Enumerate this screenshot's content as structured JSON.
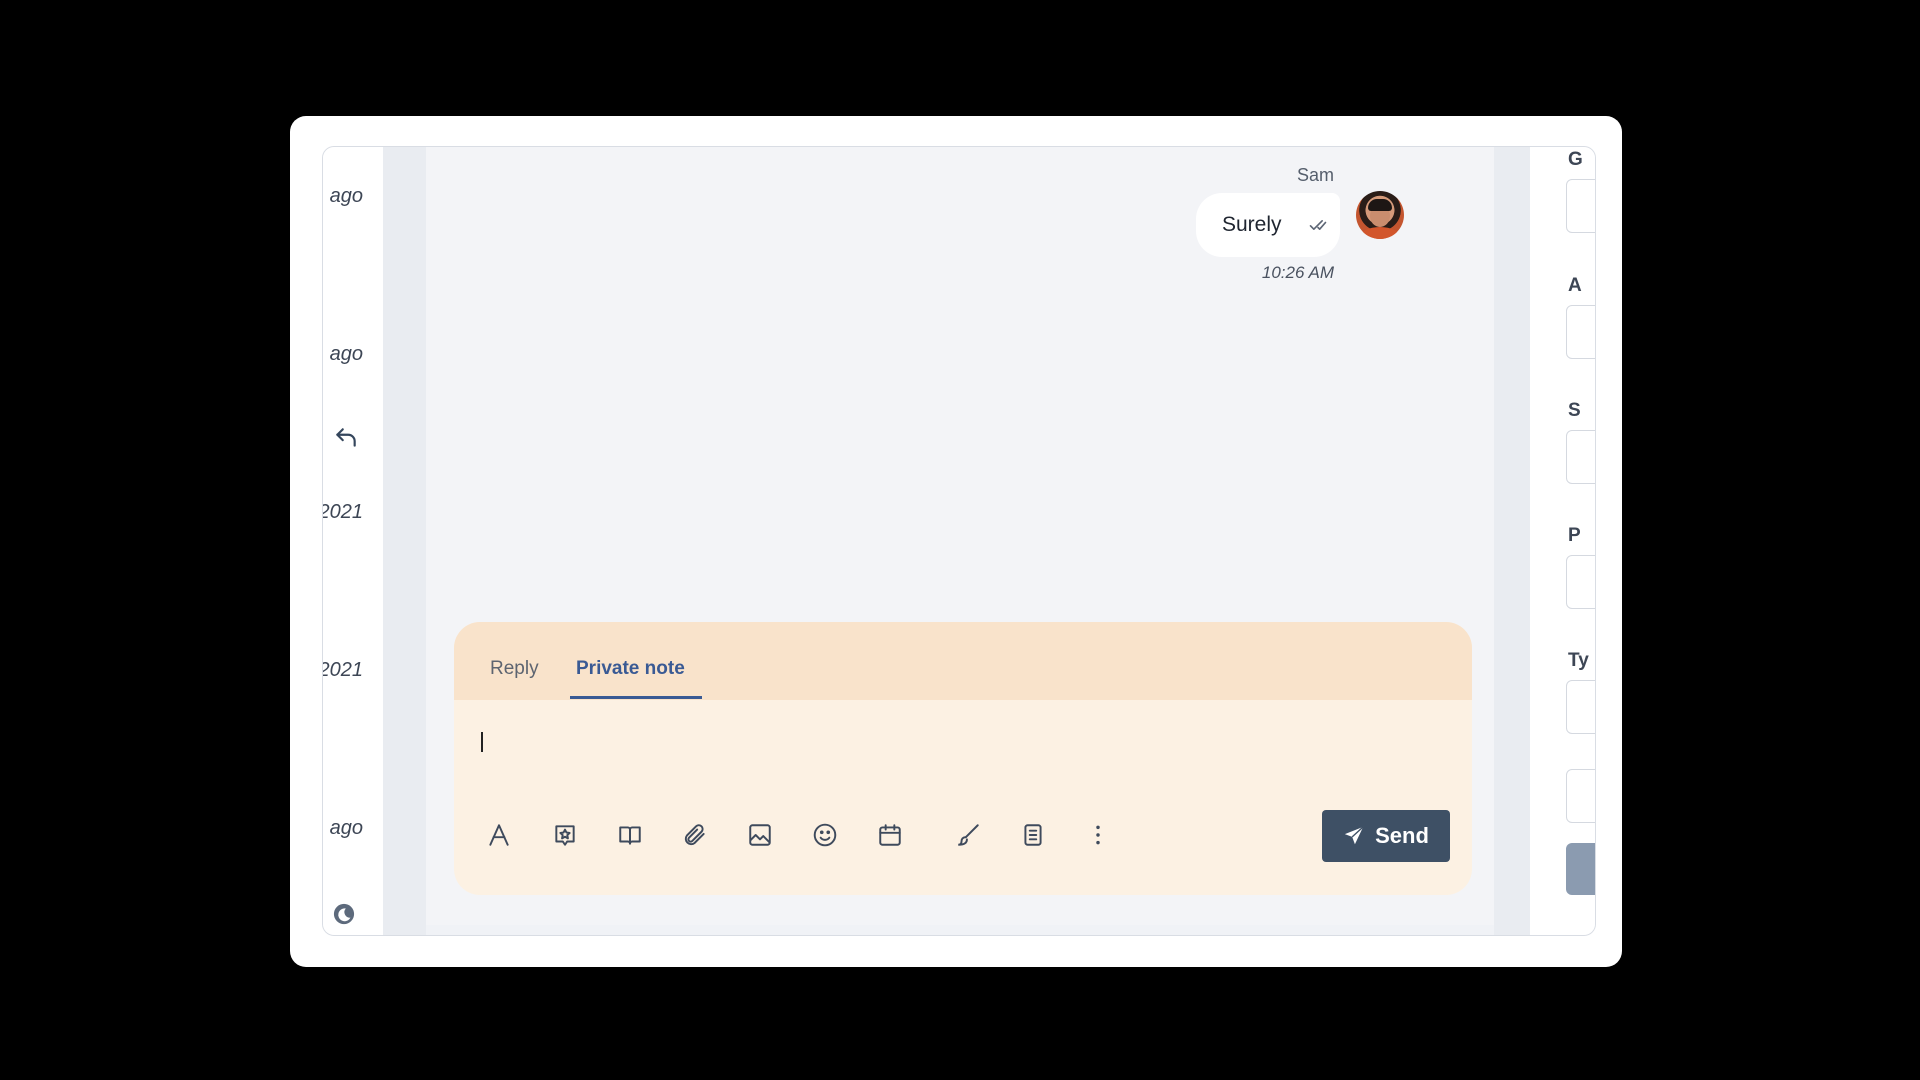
{
  "left_list": {
    "times": [
      "ago",
      "ago",
      "2021",
      "2021",
      "ago"
    ]
  },
  "conversation": {
    "sender": "Sam",
    "message": "Surely",
    "time": "10:26 AM"
  },
  "composer": {
    "tabs": [
      {
        "label": "Reply",
        "active": false
      },
      {
        "label": "Private note",
        "active": true
      }
    ],
    "toolbar_icons": [
      "text-format-icon",
      "canned-response-icon",
      "knowledge-base-icon",
      "attachment-icon",
      "image-icon",
      "emoji-icon",
      "calendar-icon",
      "signature-icon",
      "template-icon",
      "more-options-icon"
    ],
    "send_label": "Send"
  },
  "right_panel": {
    "labels": [
      "G",
      "A",
      "S",
      "P",
      "Ty"
    ]
  },
  "colors": {
    "accent": "#3a5a94",
    "send_button": "#3e5065",
    "composer_tabs_bg": "#f9e3cb",
    "composer_bg": "#fcf1e3"
  }
}
